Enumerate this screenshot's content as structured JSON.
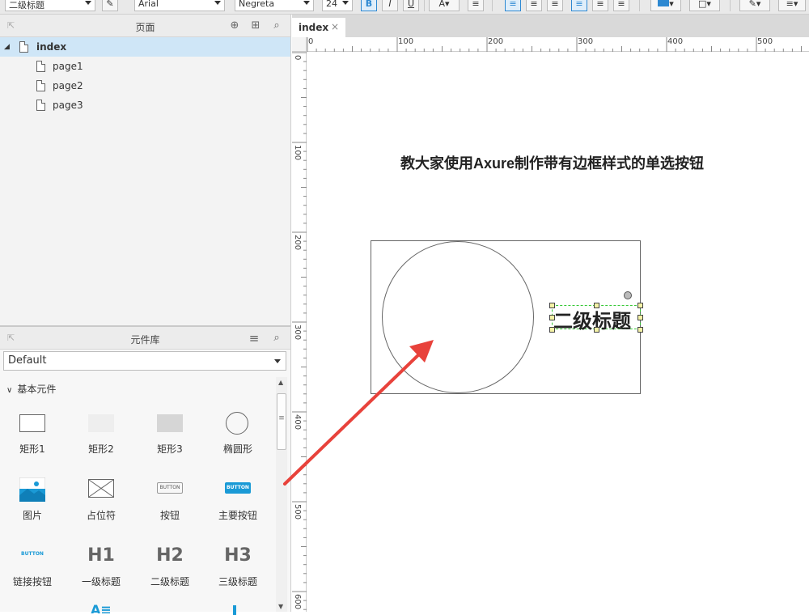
{
  "toolbar": {
    "style_select": "二级标题",
    "font_select": "Arial",
    "weight_select": "Negreta",
    "size_select": "24",
    "bold": "B",
    "italic": "I",
    "underline": "U"
  },
  "pages_panel": {
    "title": "页面",
    "items": [
      {
        "label": "index",
        "level": 0,
        "selected": true
      },
      {
        "label": "page1",
        "level": 1
      },
      {
        "label": "page2",
        "level": 1
      },
      {
        "label": "page3",
        "level": 1
      }
    ]
  },
  "widgets_panel": {
    "title": "元件库",
    "library": "Default",
    "section": "基本元件",
    "widgets": [
      {
        "label": "矩形1",
        "icon": "rectangle-icon"
      },
      {
        "label": "矩形2",
        "icon": "rectangle-light-icon"
      },
      {
        "label": "矩形3",
        "icon": "rectangle-gray-icon"
      },
      {
        "label": "椭圆形",
        "icon": "ellipse-icon"
      },
      {
        "label": "图片",
        "icon": "image-icon"
      },
      {
        "label": "占位符",
        "icon": "placeholder-icon"
      },
      {
        "label": "按钮",
        "icon": "button-icon",
        "icon_text": "BUTTON"
      },
      {
        "label": "主要按钮",
        "icon": "primary-button-icon",
        "icon_text": "BUTTON"
      },
      {
        "label": "链接按钮",
        "icon": "link-button-icon",
        "icon_text": "BUTTON"
      },
      {
        "label": "一级标题",
        "icon": "h1-icon",
        "icon_text": "H1"
      },
      {
        "label": "二级标题",
        "icon": "h2-icon",
        "icon_text": "H2"
      },
      {
        "label": "三级标题",
        "icon": "h3-icon",
        "icon_text": "H3"
      }
    ]
  },
  "editor": {
    "tab_label": "index",
    "tab_close": "×",
    "ruler_h": [
      "0",
      "100",
      "200",
      "300",
      "400",
      "500"
    ],
    "ruler_v": [
      "0",
      "100",
      "200",
      "300",
      "400",
      "500",
      "600"
    ],
    "canvas": {
      "heading": "教大家使用Axure制作带有边框样式的单选按钮",
      "selected_label": "二级标题"
    }
  },
  "colors": {
    "accent": "#2d88d1",
    "selection": "#cfe6f7",
    "arrow": "#e8423b",
    "dashed_select": "#37c837"
  }
}
